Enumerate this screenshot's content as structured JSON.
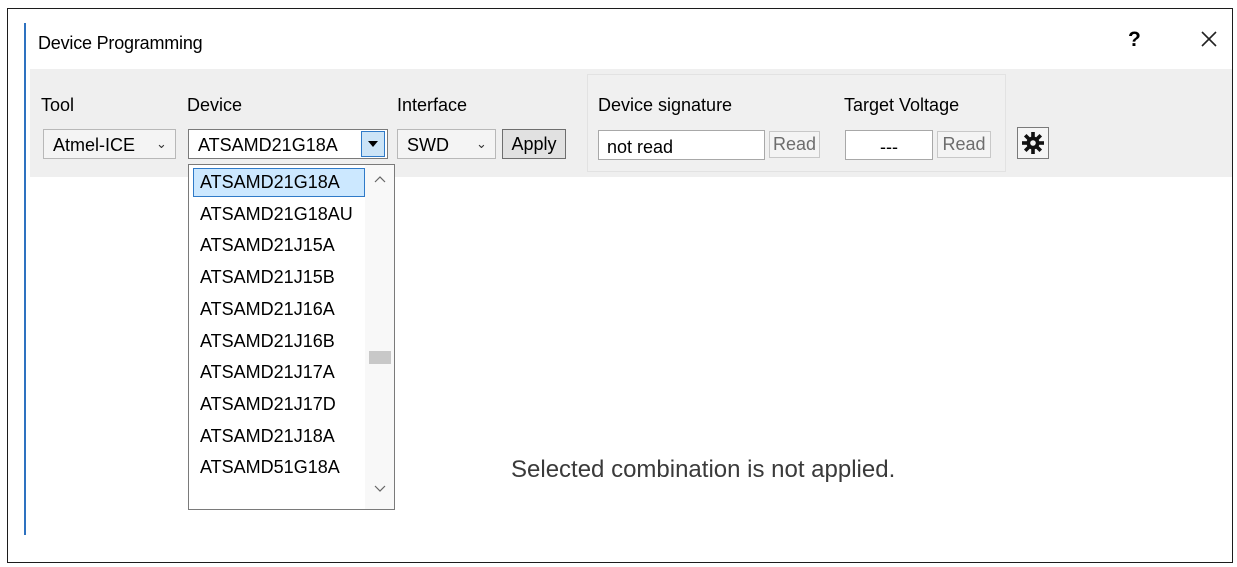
{
  "window": {
    "title": "Device Programming",
    "help_label": "?",
    "close_icon": "close-icon"
  },
  "toolbar": {
    "tool": {
      "label": "Tool",
      "value": "Atmel-ICE"
    },
    "device": {
      "label": "Device",
      "value": "ATSAMD21G18A"
    },
    "interface": {
      "label": "Interface",
      "value": "SWD"
    },
    "apply_label": "Apply",
    "signature": {
      "label": "Device signature",
      "value": "not read",
      "read_label": "Read"
    },
    "voltage": {
      "label": "Target Voltage",
      "value": "---",
      "read_label": "Read"
    },
    "settings_icon": "gear-icon"
  },
  "device_dropdown": {
    "items": [
      "ATSAMD21G18A",
      "ATSAMD21G18AU",
      "ATSAMD21J15A",
      "ATSAMD21J15B",
      "ATSAMD21J16A",
      "ATSAMD21J16B",
      "ATSAMD21J17A",
      "ATSAMD21J17D",
      "ATSAMD21J18A",
      "ATSAMD51G18A"
    ],
    "selected_index": 0
  },
  "status_message": "Selected combination is not applied.",
  "colors": {
    "accent": "#2e72c0",
    "selection_bg": "#cce8ff",
    "toolbar_bg": "#efefef"
  }
}
